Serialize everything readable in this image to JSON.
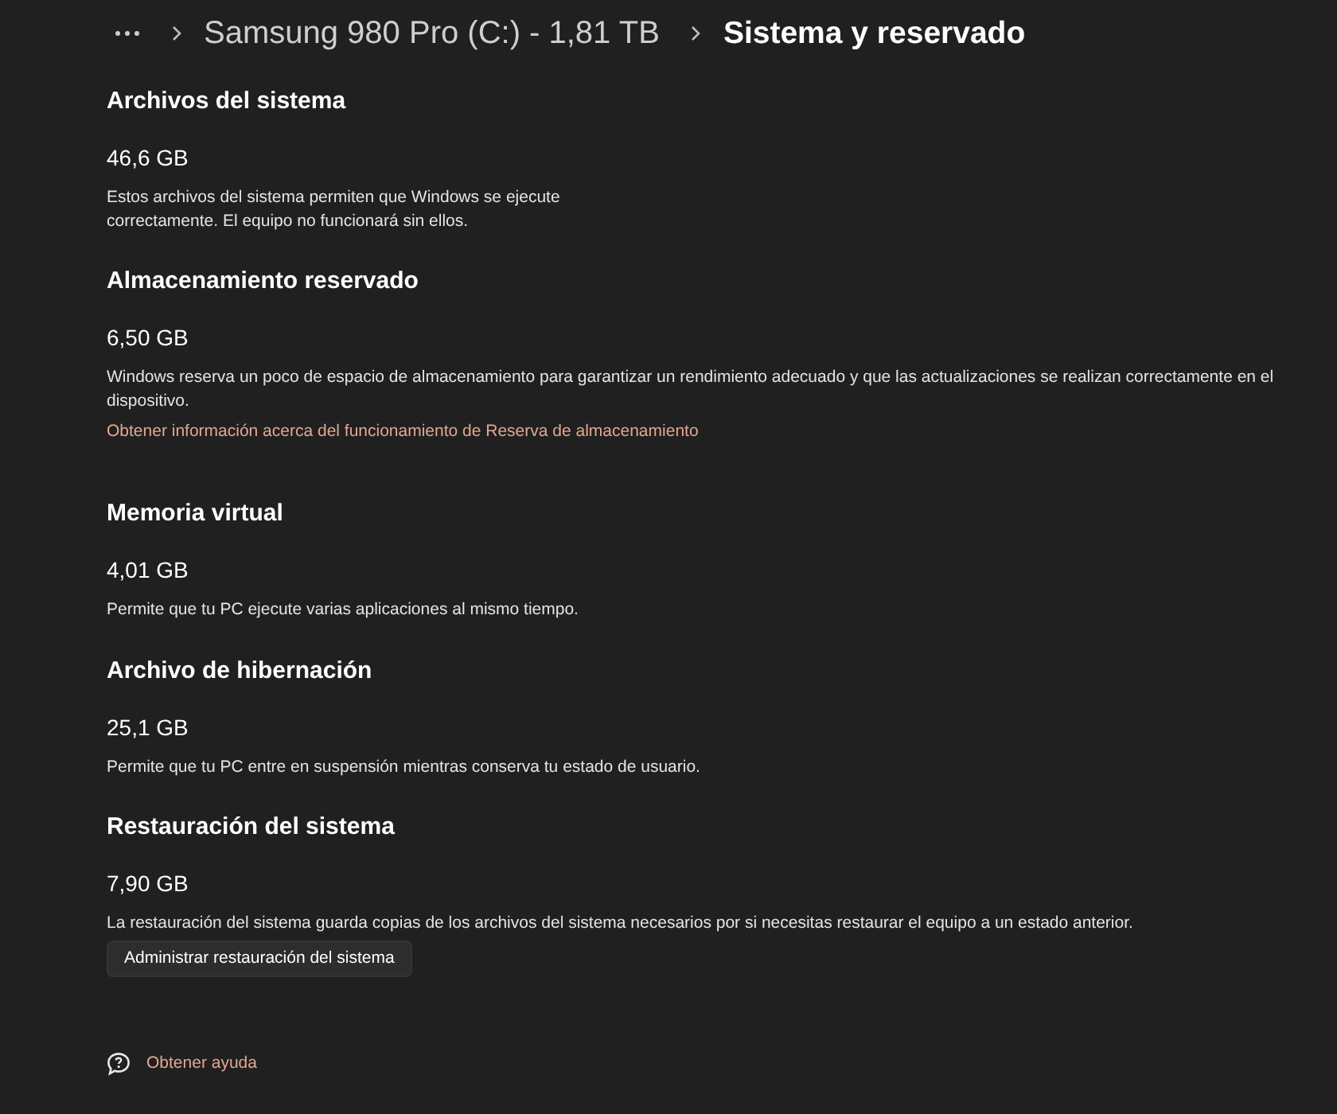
{
  "breadcrumb": {
    "items": [
      {
        "label": "Samsung 980 Pro (C:) - 1,81 TB",
        "current": false
      },
      {
        "label": "Sistema y reservado",
        "current": true
      }
    ]
  },
  "sections": [
    {
      "title": "Archivos del sistema",
      "size": "46,6 GB",
      "description": "Estos archivos del sistema permiten que Windows se ejecute correctamente. El equipo no funcionará sin ellos."
    },
    {
      "title": "Almacenamiento reservado",
      "size": "6,50 GB",
      "description": "Windows reserva un poco de espacio de almacenamiento para garantizar un rendimiento adecuado y que las actualizaciones se realizan correctamente en el dispositivo.",
      "link": "Obtener información acerca del funcionamiento de Reserva de almacenamiento"
    },
    {
      "title": "Memoria virtual",
      "size": "4,01 GB",
      "description": "Permite que tu PC ejecute varias aplicaciones al mismo tiempo."
    },
    {
      "title": "Archivo de hibernación",
      "size": "25,1 GB",
      "description": "Permite que tu PC entre en suspensión mientras conserva tu estado de usuario."
    },
    {
      "title": "Restauración del sistema",
      "size": "7,90 GB",
      "description": "La restauración del sistema guarda copias de los archivos del sistema necesarios por si necesitas restaurar el equipo a un estado anterior.",
      "button": "Administrar restauración del sistema"
    }
  ],
  "help_link": {
    "label": "Obtener ayuda"
  }
}
